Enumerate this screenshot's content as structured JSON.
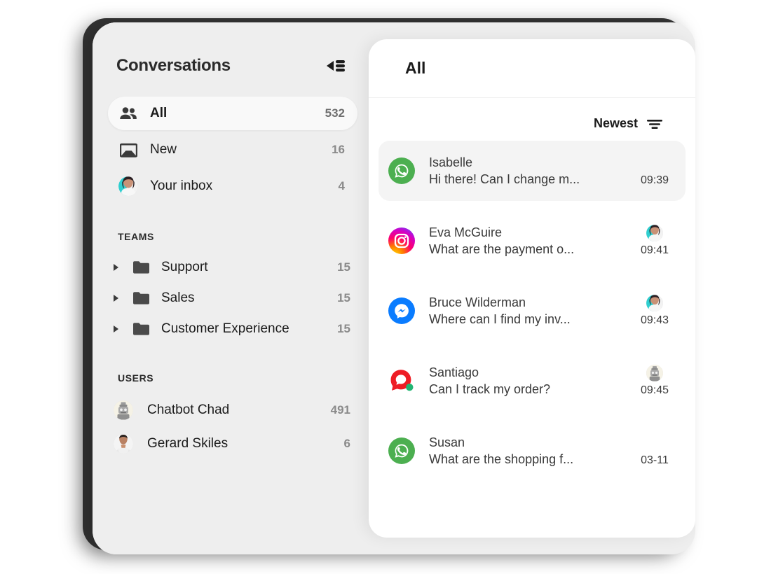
{
  "window": {
    "sidebar": {
      "title": "Conversations",
      "collapse_icon": "collapse-sidebar-icon",
      "nav": [
        {
          "label": "All",
          "count": "532",
          "icon": "people-icon",
          "selected": true
        },
        {
          "label": "New",
          "count": "16",
          "icon": "inbox-tray-icon",
          "selected": false
        },
        {
          "label": "Your inbox",
          "count": "4",
          "icon": "user-avatar",
          "selected": false
        }
      ],
      "teams_section_label": "TEAMS",
      "teams": [
        {
          "label": "Support",
          "count": "15",
          "icon": "folder-icon",
          "expander": "triangle-right-icon"
        },
        {
          "label": "Sales",
          "count": "15",
          "icon": "folder-icon",
          "expander": "triangle-right-icon"
        },
        {
          "label": "Customer Experience",
          "count": "15",
          "icon": "folder-icon",
          "expander": "triangle-right-icon"
        }
      ],
      "users_section_label": "USERS",
      "users": [
        {
          "label": "Chatbot Chad",
          "count": "491",
          "avatar": "robot-avatar"
        },
        {
          "label": "Gerard Skiles",
          "count": "6",
          "avatar": "man-avatar"
        }
      ]
    },
    "conversations": {
      "title": "All",
      "sort_label": "Newest",
      "sort_icon": "sort-descending-icon",
      "rows": [
        {
          "name": "Isabelle",
          "preview": "Hi there! Can I change m...",
          "time": "09:39",
          "channel": "whatsapp-icon",
          "assignee": null,
          "selected": true,
          "online": false
        },
        {
          "name": "Eva McGuire",
          "preview": "What are the payment o...",
          "time": "09:41",
          "channel": "instagram-icon",
          "assignee": "woman-avatar",
          "selected": false,
          "online": false
        },
        {
          "name": "Bruce Wilderman",
          "preview": "Where can I find my inv...",
          "time": "09:43",
          "channel": "messenger-icon",
          "assignee": "woman-avatar",
          "selected": false,
          "online": false
        },
        {
          "name": "Santiago",
          "preview": "Can I track my order?",
          "time": "09:45",
          "channel": "livechat-icon",
          "assignee": "robot-avatar",
          "selected": false,
          "online": true
        },
        {
          "name": "Susan",
          "preview": "What are the shopping f...",
          "time": "03-11",
          "channel": "whatsapp-icon",
          "assignee": null,
          "selected": false,
          "online": false
        }
      ]
    }
  },
  "colors": {
    "sidebar_bg": "#eeeeee",
    "panel_bg": "#ffffff",
    "selected_nav": "#f9f9f9",
    "selected_row": "#f4f4f4",
    "whatsapp_green": "#4caf50",
    "messenger_blue": "#0a7cff",
    "livechat_red": "#ee1d25",
    "online_green": "#22b573",
    "text_primary": "#1b1b1b",
    "text_secondary": "#8a8a8a"
  }
}
